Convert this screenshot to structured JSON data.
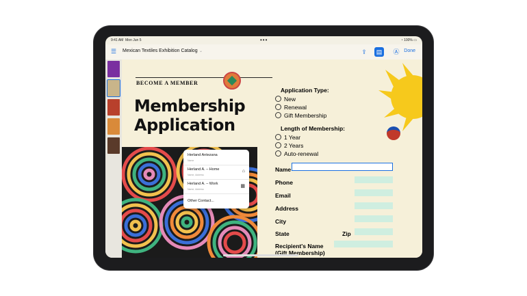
{
  "status": {
    "time": "9:41 AM",
    "date": "Mon Jun 5",
    "battery": "100%"
  },
  "toolbar": {
    "title": "Mexican Textiles Exhibition Catalog",
    "done": "Done"
  },
  "document": {
    "become": "BECOME A MEMBER",
    "headline_1": "Membership",
    "headline_2": "Application",
    "app_type": "Application Type:",
    "app_opts": [
      "New",
      "Renewal",
      "Gift Membership"
    ],
    "length": "Length of Membership:",
    "length_opts": [
      "1 Year",
      "2 Years",
      "Auto-renewal"
    ],
    "fields": [
      "Name",
      "Phone",
      "Email",
      "Address",
      "City",
      "State",
      "Zip"
    ],
    "recipient_1": "Recipient's Name",
    "recipient_2": "(Gift Membership)"
  },
  "autofill": {
    "items": [
      {
        "name": "Herland Antezana",
        "sub": "Name",
        "icon": ""
      },
      {
        "name": "Herland A. – Home",
        "sub": "Name, Address",
        "icon": "home-icon"
      },
      {
        "name": "Herland A. – Work",
        "sub": "Name, Address",
        "icon": "building-icon"
      }
    ],
    "other": "Other Contact..."
  }
}
